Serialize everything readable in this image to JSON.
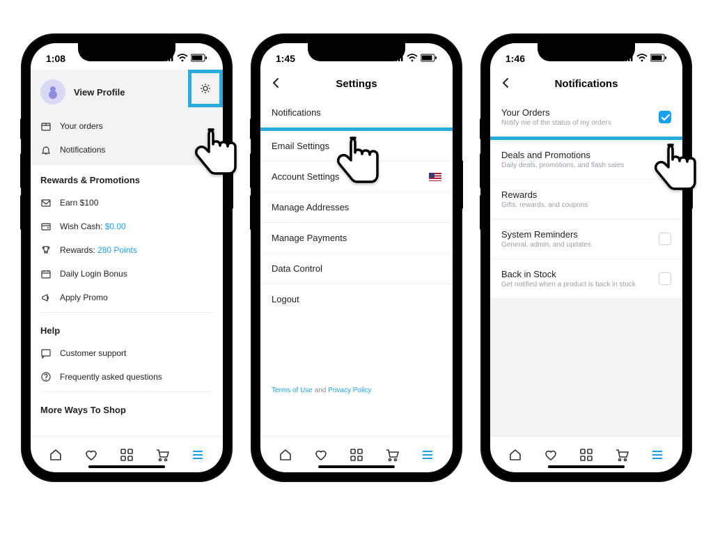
{
  "accent": "#1aa0e8",
  "highlight": "#29abe2",
  "phones": [
    {
      "time": "1:08",
      "profile_label": "View Profile",
      "menu": [
        {
          "icon": "box",
          "label": "Your orders"
        },
        {
          "icon": "bell",
          "label": "Notifications"
        }
      ],
      "rewards_header": "Rewards & Promotions",
      "rewards": [
        {
          "icon": "mail",
          "label": "Earn $100"
        },
        {
          "icon": "card",
          "prefix": "Wish Cash: ",
          "value": "$0.00"
        },
        {
          "icon": "trophy",
          "prefix": "Rewards: ",
          "value": "280 Points"
        },
        {
          "icon": "calendar",
          "label": "Daily Login Bonus"
        },
        {
          "icon": "megaphone",
          "label": "Apply Promo"
        }
      ],
      "help_header": "Help",
      "help": [
        {
          "icon": "chat",
          "label": "Customer support"
        },
        {
          "icon": "question",
          "label": "Frequently asked questions"
        }
      ],
      "more_header": "More Ways To Shop"
    },
    {
      "time": "1:45",
      "title": "Settings",
      "items": [
        {
          "label": "Notifications",
          "highlight": true
        },
        {
          "label": "Email Settings"
        },
        {
          "label": "Account Settings",
          "flag": true
        },
        {
          "label": "Manage Addresses"
        },
        {
          "label": "Manage Payments"
        },
        {
          "label": "Data Control"
        },
        {
          "label": "Logout"
        }
      ],
      "footer": {
        "terms": "Terms of Use",
        "and": " and ",
        "privacy": "Privacy Policy"
      }
    },
    {
      "time": "1:46",
      "title": "Notifications",
      "items": [
        {
          "label": "Your Orders",
          "sub": "Notify me of the status of my orders",
          "checked": true,
          "highlight": true
        },
        {
          "label": "Deals and Promotions",
          "sub": "Daily deals, promotions, and flash sales"
        },
        {
          "label": "Rewards",
          "sub": "Gifts, rewards, and coupons"
        },
        {
          "label": "System Reminders",
          "sub": "General, admin, and updates",
          "checkbox": true
        },
        {
          "label": "Back in Stock",
          "sub": "Get notified when a product is back in stock",
          "checkbox": true
        }
      ]
    }
  ],
  "tabbar_icons": [
    "home",
    "heart",
    "grid",
    "cart",
    "menu"
  ]
}
